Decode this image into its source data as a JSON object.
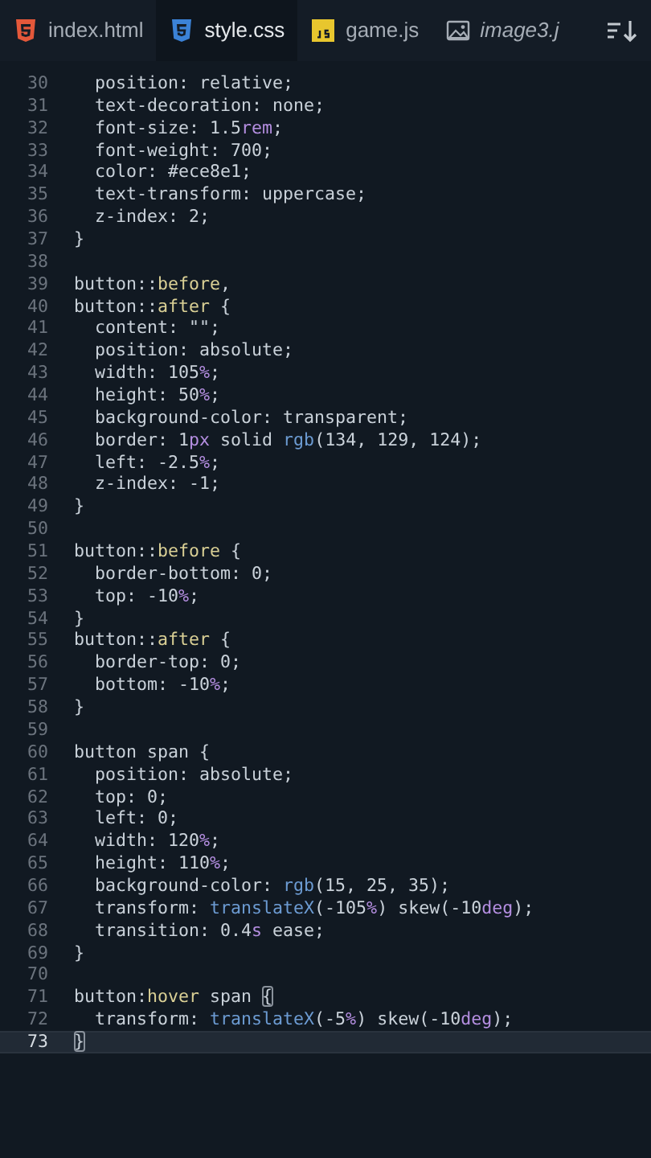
{
  "tabs": [
    {
      "label": "index.html",
      "kind": "html",
      "selected": false,
      "preview": false
    },
    {
      "label": "style.css",
      "kind": "css",
      "selected": true,
      "preview": false
    },
    {
      "label": "game.js",
      "kind": "js",
      "selected": false,
      "preview": false
    },
    {
      "label": "image3.j",
      "kind": "image",
      "selected": false,
      "preview": true
    }
  ],
  "lines": [
    {
      "number": "30",
      "current": false,
      "tokens": [
        {
          "text": "  position: relative;",
          "kind": "plain"
        }
      ]
    },
    {
      "number": "31",
      "current": false,
      "tokens": [
        {
          "text": "  text-decoration: none;",
          "kind": "plain"
        }
      ]
    },
    {
      "number": "32",
      "current": false,
      "tokens": [
        {
          "text": "  font-size: 1.5",
          "kind": "plain"
        },
        {
          "text": "rem",
          "kind": "unit"
        },
        {
          "text": ";",
          "kind": "plain"
        }
      ]
    },
    {
      "number": "33",
      "current": false,
      "tokens": [
        {
          "text": "  font-weight: 700;",
          "kind": "plain"
        }
      ]
    },
    {
      "number": "34",
      "current": false,
      "tokens": [
        {
          "text": "  color: #ece8e1;",
          "kind": "plain"
        }
      ]
    },
    {
      "number": "35",
      "current": false,
      "tokens": [
        {
          "text": "  text-transform: uppercase;",
          "kind": "plain"
        }
      ]
    },
    {
      "number": "36",
      "current": false,
      "tokens": [
        {
          "text": "  z-index: 2;",
          "kind": "plain"
        }
      ]
    },
    {
      "number": "37",
      "current": false,
      "tokens": [
        {
          "text": "}",
          "kind": "plain"
        }
      ]
    },
    {
      "number": "38",
      "current": false
    },
    {
      "number": "39",
      "current": false,
      "tokens": [
        {
          "text": "button::",
          "kind": "plain"
        },
        {
          "text": "before",
          "kind": "pseudo"
        },
        {
          "text": ",",
          "kind": "plain"
        }
      ]
    },
    {
      "number": "40",
      "current": false,
      "tokens": [
        {
          "text": "button::",
          "kind": "plain"
        },
        {
          "text": "after",
          "kind": "pseudo"
        },
        {
          "text": " {",
          "kind": "plain"
        }
      ]
    },
    {
      "number": "41",
      "current": false,
      "tokens": [
        {
          "text": "  content: \"\";",
          "kind": "plain"
        }
      ]
    },
    {
      "number": "42",
      "current": false,
      "tokens": [
        {
          "text": "  position: absolute;",
          "kind": "plain"
        }
      ]
    },
    {
      "number": "43",
      "current": false,
      "tokens": [
        {
          "text": "  width: 105",
          "kind": "plain"
        },
        {
          "text": "%",
          "kind": "unit"
        },
        {
          "text": ";",
          "kind": "plain"
        }
      ]
    },
    {
      "number": "44",
      "current": false,
      "tokens": [
        {
          "text": "  height: 50",
          "kind": "plain"
        },
        {
          "text": "%",
          "kind": "unit"
        },
        {
          "text": ";",
          "kind": "plain"
        }
      ]
    },
    {
      "number": "45",
      "current": false,
      "tokens": [
        {
          "text": "  background-color: transparent;",
          "kind": "plain"
        }
      ]
    },
    {
      "number": "46",
      "current": false,
      "tokens": [
        {
          "text": "  border: 1",
          "kind": "plain"
        },
        {
          "text": "px",
          "kind": "unit"
        },
        {
          "text": " solid ",
          "kind": "plain"
        },
        {
          "text": "rgb",
          "kind": "function"
        },
        {
          "text": "(134, 129, 124);",
          "kind": "plain"
        }
      ]
    },
    {
      "number": "47",
      "current": false,
      "tokens": [
        {
          "text": "  left: -2.5",
          "kind": "plain"
        },
        {
          "text": "%",
          "kind": "unit"
        },
        {
          "text": ";",
          "kind": "plain"
        }
      ]
    },
    {
      "number": "48",
      "current": false,
      "tokens": [
        {
          "text": "  z-index: -1;",
          "kind": "plain"
        }
      ]
    },
    {
      "number": "49",
      "current": false,
      "tokens": [
        {
          "text": "}",
          "kind": "plain"
        }
      ]
    },
    {
      "number": "50",
      "current": false
    },
    {
      "number": "51",
      "current": false,
      "tokens": [
        {
          "text": "button::",
          "kind": "plain"
        },
        {
          "text": "before",
          "kind": "pseudo"
        },
        {
          "text": " {",
          "kind": "plain"
        }
      ]
    },
    {
      "number": "52",
      "current": false,
      "tokens": [
        {
          "text": "  border-bottom: 0;",
          "kind": "plain"
        }
      ]
    },
    {
      "number": "53",
      "current": false,
      "tokens": [
        {
          "text": "  top: -10",
          "kind": "plain"
        },
        {
          "text": "%",
          "kind": "unit"
        },
        {
          "text": ";",
          "kind": "plain"
        }
      ]
    },
    {
      "number": "54",
      "current": false,
      "tokens": [
        {
          "text": "}",
          "kind": "plain"
        }
      ]
    },
    {
      "number": "55",
      "current": false,
      "tokens": [
        {
          "text": "button::",
          "kind": "plain"
        },
        {
          "text": "after",
          "kind": "pseudo"
        },
        {
          "text": " {",
          "kind": "plain"
        }
      ]
    },
    {
      "number": "56",
      "current": false,
      "tokens": [
        {
          "text": "  border-top: 0;",
          "kind": "plain"
        }
      ]
    },
    {
      "number": "57",
      "current": false,
      "tokens": [
        {
          "text": "  bottom: -10",
          "kind": "plain"
        },
        {
          "text": "%",
          "kind": "unit"
        },
        {
          "text": ";",
          "kind": "plain"
        }
      ]
    },
    {
      "number": "58",
      "current": false,
      "tokens": [
        {
          "text": "}",
          "kind": "plain"
        }
      ]
    },
    {
      "number": "59",
      "current": false
    },
    {
      "number": "60",
      "current": false,
      "tokens": [
        {
          "text": "button span {",
          "kind": "plain"
        }
      ]
    },
    {
      "number": "61",
      "current": false,
      "tokens": [
        {
          "text": "  position: absolute;",
          "kind": "plain"
        }
      ]
    },
    {
      "number": "62",
      "current": false,
      "tokens": [
        {
          "text": "  top: 0;",
          "kind": "plain"
        }
      ]
    },
    {
      "number": "63",
      "current": false,
      "tokens": [
        {
          "text": "  left: 0;",
          "kind": "plain"
        }
      ]
    },
    {
      "number": "64",
      "current": false,
      "tokens": [
        {
          "text": "  width: 120",
          "kind": "plain"
        },
        {
          "text": "%",
          "kind": "unit"
        },
        {
          "text": ";",
          "kind": "plain"
        }
      ]
    },
    {
      "number": "65",
      "current": false,
      "tokens": [
        {
          "text": "  height: 110",
          "kind": "plain"
        },
        {
          "text": "%",
          "kind": "unit"
        },
        {
          "text": ";",
          "kind": "plain"
        }
      ]
    },
    {
      "number": "66",
      "current": false,
      "tokens": [
        {
          "text": "  background-color: ",
          "kind": "plain"
        },
        {
          "text": "rgb",
          "kind": "function"
        },
        {
          "text": "(15, 25, 35);",
          "kind": "plain"
        }
      ]
    },
    {
      "number": "67",
      "current": false,
      "tokens": [
        {
          "text": "  transform: ",
          "kind": "plain"
        },
        {
          "text": "translateX",
          "kind": "function"
        },
        {
          "text": "(-105",
          "kind": "plain"
        },
        {
          "text": "%",
          "kind": "unit"
        },
        {
          "text": ") skew(-10",
          "kind": "plain"
        },
        {
          "text": "deg",
          "kind": "unit"
        },
        {
          "text": ");",
          "kind": "plain"
        }
      ]
    },
    {
      "number": "68",
      "current": false,
      "tokens": [
        {
          "text": "  transition: 0.4",
          "kind": "plain"
        },
        {
          "text": "s",
          "kind": "unit"
        },
        {
          "text": " ease;",
          "kind": "plain"
        }
      ]
    },
    {
      "number": "69",
      "current": false,
      "tokens": [
        {
          "text": "}",
          "kind": "plain"
        }
      ]
    },
    {
      "number": "70",
      "current": false
    },
    {
      "number": "71",
      "current": false,
      "tokens": [
        {
          "text": "button:",
          "kind": "plain"
        },
        {
          "text": "hover",
          "kind": "pseudo"
        },
        {
          "text": " span ",
          "kind": "plain"
        },
        {
          "text": "{",
          "kind": "bracket"
        }
      ]
    },
    {
      "number": "72",
      "current": false,
      "tokens": [
        {
          "text": "  transform: ",
          "kind": "plain"
        },
        {
          "text": "translateX",
          "kind": "function"
        },
        {
          "text": "(-5",
          "kind": "plain"
        },
        {
          "text": "%",
          "kind": "unit"
        },
        {
          "text": ") skew(-10",
          "kind": "plain"
        },
        {
          "text": "deg",
          "kind": "unit"
        },
        {
          "text": ");",
          "kind": "plain"
        }
      ]
    },
    {
      "number": "73",
      "current": true,
      "tokens": [
        {
          "text": "}",
          "kind": "bracket"
        }
      ]
    }
  ]
}
